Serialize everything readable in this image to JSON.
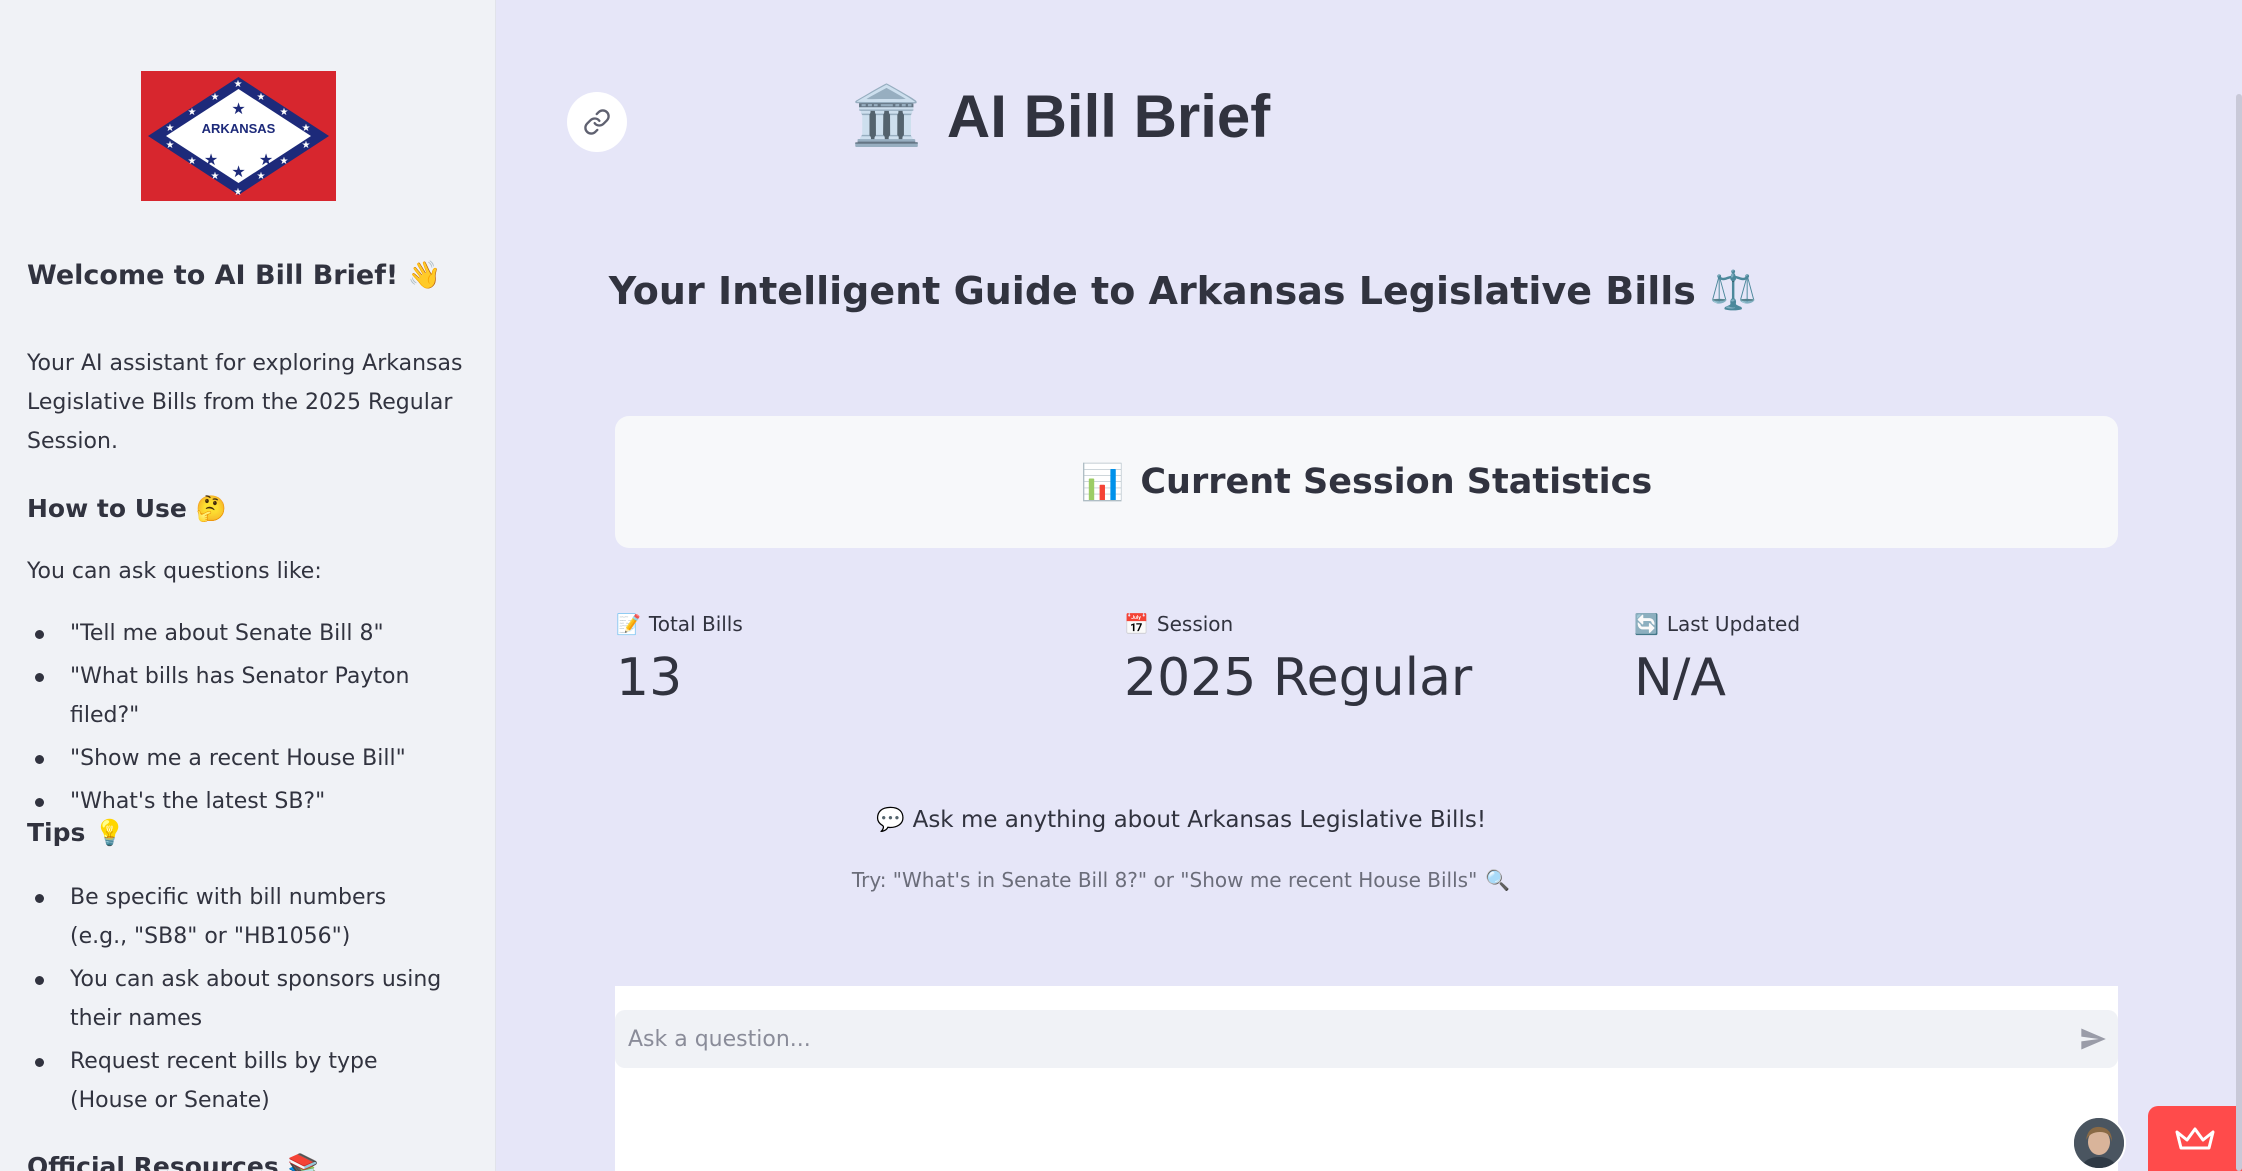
{
  "sidebar": {
    "flag_text": "ARKANSAS",
    "welcome_heading": "Welcome to AI Bill Brief!",
    "intro": "Your AI assistant for exploring Arkansas Legislative Bills from the 2025 Regular Session.",
    "how_to_heading": "How to Use",
    "how_to_intro": "You can ask questions like:",
    "examples": [
      "\"Tell me about Senate Bill 8\"",
      "\"What bills has Senator Payton filed?\"",
      "\"Show me a recent House Bill\"",
      "\"What's the latest SB?\""
    ],
    "tips_heading": "Tips",
    "tips": [
      "Be specific with bill numbers (e.g., \"SB8\" or \"HB1056\")",
      "You can ask about sponsors using their names",
      "Request recent bills by type (House or Senate)"
    ],
    "resources_heading": "Official Resources"
  },
  "header": {
    "title": "AI Bill Brief",
    "subtitle": "Your Intelligent Guide to Arkansas Legislative Bills"
  },
  "stats": {
    "heading": "Current Session Statistics",
    "metrics": [
      {
        "label": "Total Bills",
        "value": "13",
        "icon": "memo-icon"
      },
      {
        "label": "Session",
        "value": "2025 Regular",
        "icon": "calendar-icon"
      },
      {
        "label": "Last Updated",
        "value": "N/A",
        "icon": "refresh-icon"
      }
    ]
  },
  "prompt": {
    "ask": "Ask me anything about Arkansas Legislative Bills!",
    "try": "Try: \"What's in Senate Bill 8?\" or \"Show me recent House Bills\""
  },
  "chat": {
    "placeholder": "Ask a question..."
  },
  "colors": {
    "main_bg": "#e6e6f8",
    "sidebar_bg": "#f0f2f6",
    "text": "#31333f",
    "badge": "#ff4b4b"
  }
}
